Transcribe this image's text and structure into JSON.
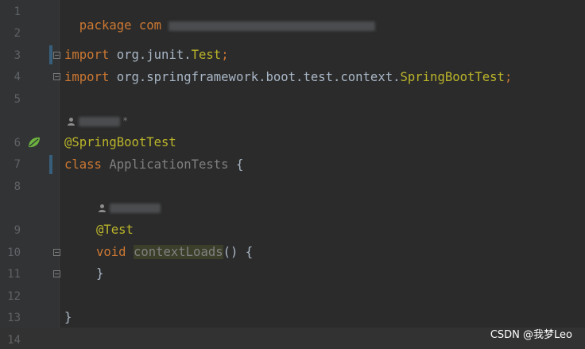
{
  "lines": [
    {
      "no": "1",
      "text": "package com"
    },
    {
      "no": "2",
      "text": ""
    },
    {
      "no": "3",
      "kw": "import",
      "pkg": " org.junit.",
      "type": "Test",
      "end": ";"
    },
    {
      "no": "4",
      "kw": "import",
      "pkg": " org.springframework.boot.test.context.",
      "type": "SpringBootTest",
      "end": ";"
    },
    {
      "no": "5",
      "text": ""
    },
    {
      "no": "6",
      "text": "@SpringBootTest"
    },
    {
      "no": "7",
      "kw": "class",
      "cls": " ApplicationTests",
      "end": " {"
    },
    {
      "no": "8",
      "text": ""
    },
    {
      "no": "9",
      "text": "@Test"
    },
    {
      "no": "10",
      "kw": "void",
      "method": "contextLoads",
      "end": "() {"
    },
    {
      "no": "11",
      "text": "}"
    },
    {
      "no": "12",
      "text": ""
    },
    {
      "no": "13",
      "text": "}"
    },
    {
      "no": "14",
      "text": ""
    }
  ],
  "hints": {
    "author_star": "*"
  },
  "watermark": "CSDN @我梦Leo",
  "icons": {
    "user": "user-icon",
    "spring": "spring-leaf-icon",
    "fold": "fold-icon"
  }
}
